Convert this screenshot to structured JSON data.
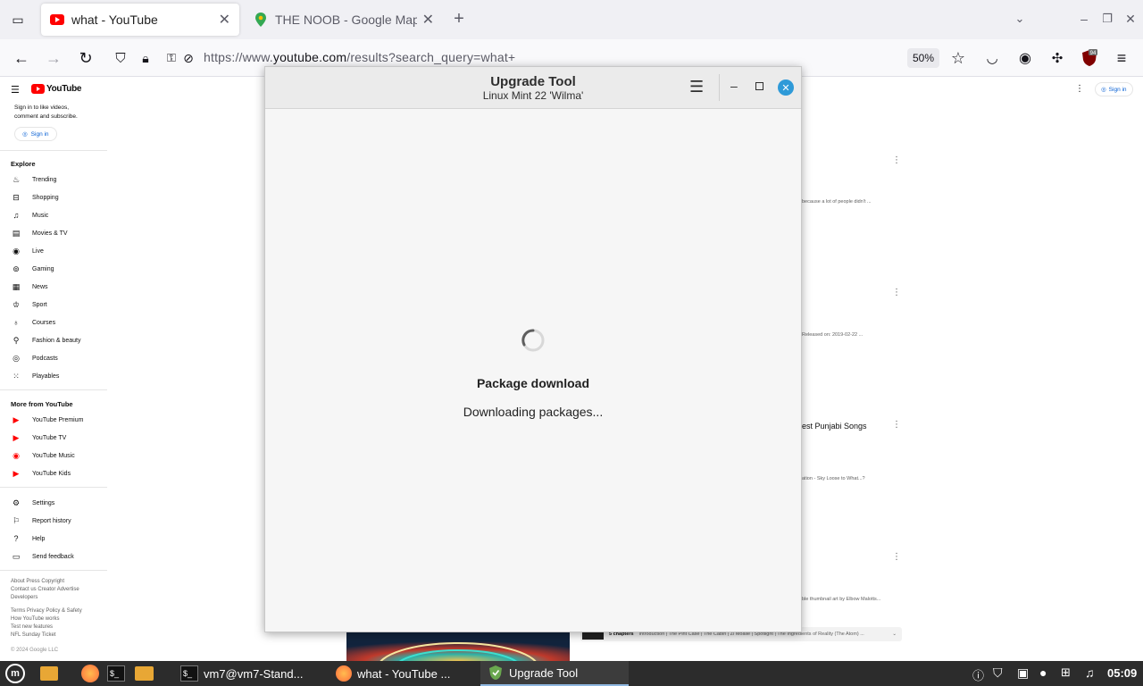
{
  "browser": {
    "tabs": [
      {
        "title": "what - YouTube",
        "active": true
      },
      {
        "title": "THE NOOB - Google Maps",
        "active": false
      }
    ],
    "url_prefix": "https://www.",
    "url_domain": "youtube.com",
    "url_path": "/results?search_query=what+",
    "zoom": "50%",
    "extension_badge": "94"
  },
  "youtube": {
    "logo_text": "YouTube",
    "signin_prompt_1": "Sign in to like videos,",
    "signin_prompt_2": "comment and subscribe.",
    "signin_button": "Sign in",
    "top_signin": "Sign in",
    "explore_header": "Explore",
    "explore": [
      "Trending",
      "Shopping",
      "Music",
      "Movies & TV",
      "Live",
      "Gaming",
      "News",
      "Sport",
      "Courses",
      "Fashion & beauty",
      "Podcasts",
      "Playables"
    ],
    "more_header": "More from YouTube",
    "more": [
      "YouTube Premium",
      "YouTube TV",
      "YouTube Music",
      "YouTube Kids"
    ],
    "settings": [
      "Settings",
      "Report history",
      "Help",
      "Send feedback"
    ],
    "footer_1": "About  Press  Copyright",
    "footer_2": "Contact us  Creator  Advertise",
    "footer_3": "Developers",
    "footer_4": "Terms  Privacy  Policy & Safety",
    "footer_5": "How YouTube works",
    "footer_6": "Test new features",
    "footer_7": "NFL Sunday Ticket",
    "copyright": "© 2024 Google LLC",
    "results": [
      {
        "snippet": "because a lot of people didn't ..."
      },
      {
        "snippet": "Released on: 2019-02-22 ..."
      },
      {
        "title": "est Punjabi Songs",
        "snippet": "ation - Sky Loose to What...?"
      },
      {
        "snippet": "ble thumbnail art by Elbow Malotts..."
      }
    ],
    "chapters_label": "5 chapters",
    "chapters_text": "Introduction | The Pint Case | The Cabin | Zi Moalle | Spotlight | The Ingredients of Reality (The Atom) ..."
  },
  "dialog": {
    "title": "Upgrade Tool",
    "subtitle": "Linux Mint 22 'Wilma'",
    "heading": "Package download",
    "status": "Downloading packages..."
  },
  "taskbar": {
    "items": [
      {
        "label": "vm7@vm7-Stand..."
      },
      {
        "label": "what - YouTube ..."
      },
      {
        "label": "Upgrade Tool",
        "active": true
      }
    ],
    "clock": "05:09"
  },
  "colors": {
    "youtube_red": "#ff0000",
    "dialog_close": "#2e9ad8",
    "taskbar_bg": "#2c2c2c"
  }
}
